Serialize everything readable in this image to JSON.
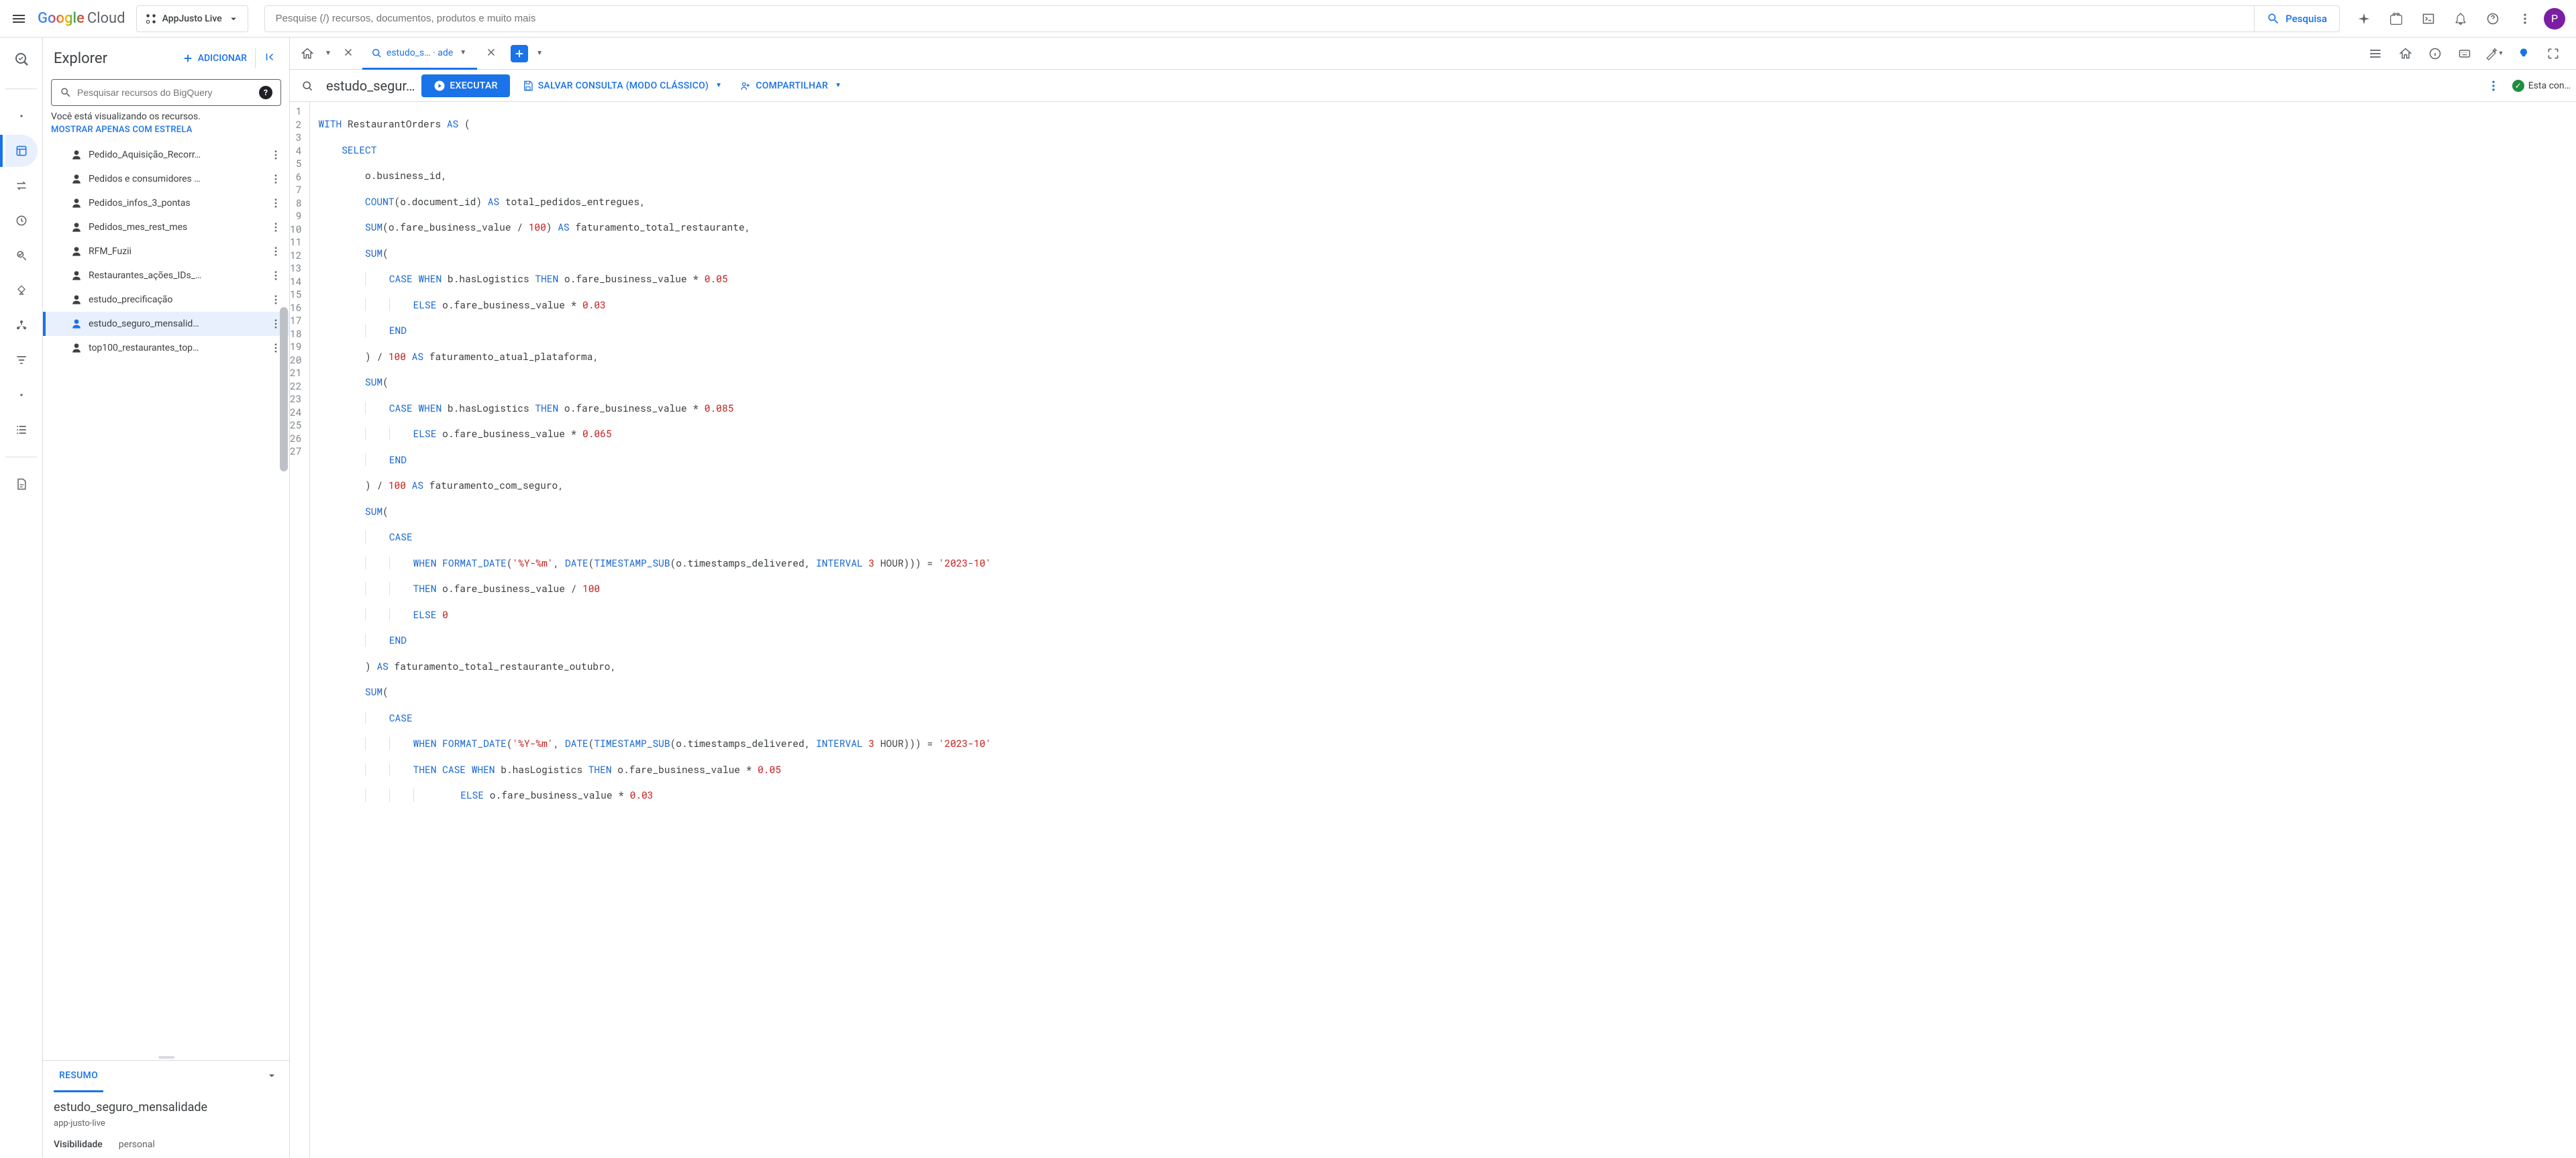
{
  "header": {
    "logo_google": "Google",
    "logo_cloud": "Cloud",
    "project": "AppJusto Live",
    "search_placeholder": "Pesquise (/) recursos, documentos, produtos e muito mais",
    "search_button": "Pesquisa",
    "avatar_initial": "P"
  },
  "explorer": {
    "title": "Explorer",
    "add_button": "ADICIONAR",
    "search_placeholder": "Pesquisar recursos do BigQuery",
    "viewing_text": "Você está visualizando os recursos.",
    "star_link": "MOSTRAR APENAS COM ESTRELA",
    "items": [
      {
        "label": "Pedido_Aquisição_Recorr…"
      },
      {
        "label": "Pedidos e consumidores …"
      },
      {
        "label": "Pedidos_infos_3_pontas"
      },
      {
        "label": "Pedidos_mes_rest_mes"
      },
      {
        "label": "RFM_Fuzii"
      },
      {
        "label": "Restaurantes_ações_IDs_…"
      },
      {
        "label": "estudo_precificação"
      },
      {
        "label": "estudo_seguro_mensalid…"
      },
      {
        "label": "top100_restaurantes_top…"
      }
    ]
  },
  "summary": {
    "tab": "RESUMO",
    "title": "estudo_seguro_mensalidade",
    "subtitle": "app-justo-live",
    "visibility_key": "Visibilidade",
    "visibility_val": "personal"
  },
  "tabs": {
    "active_tab": "estudo_s… · ade"
  },
  "query": {
    "name": "estudo_segur…",
    "run": "EXECUTAR",
    "save": "SALVAR CONSULTA (MODO CLÁSSICO)",
    "share": "COMPARTILHAR",
    "status": "Esta con…"
  },
  "code": {
    "lines": 27
  }
}
